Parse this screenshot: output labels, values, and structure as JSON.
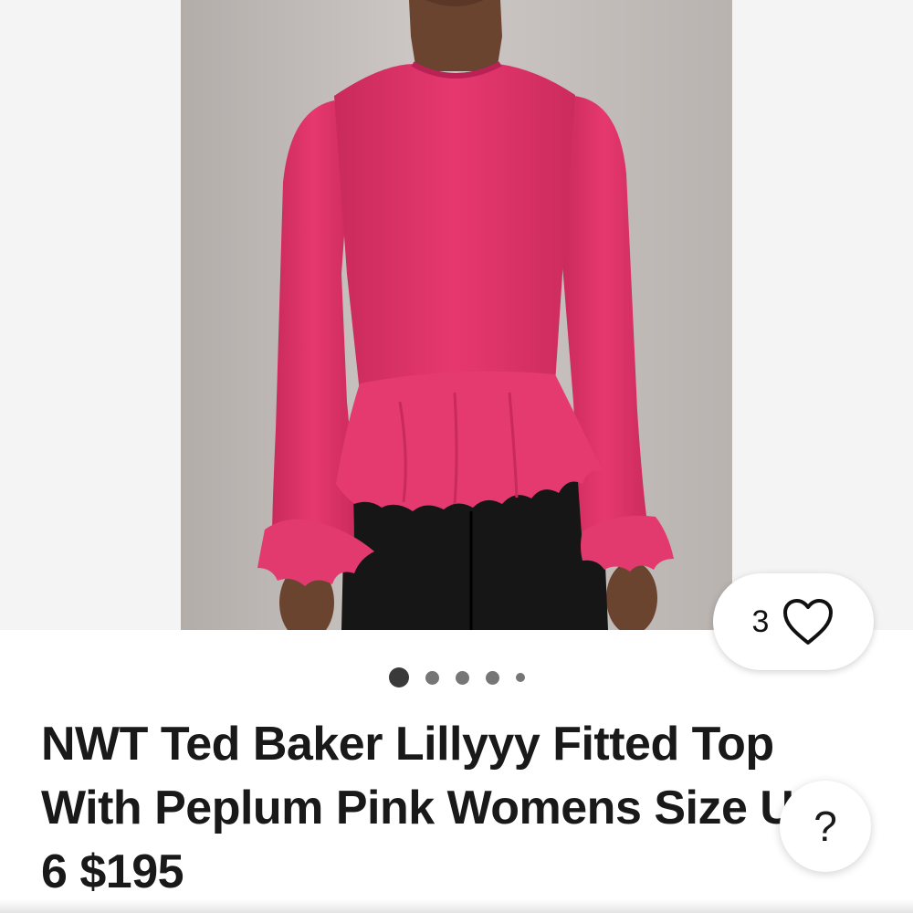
{
  "gallery": {
    "image_alt": "Pink peplum top worn by model",
    "like_count": "3",
    "heart_icon": "heart-outline-icon",
    "dot_count": 5,
    "active_dot": 1
  },
  "listing": {
    "title": "NWT Ted Baker Lillyyy Fitted Top With Peplum Pink Womens Size US 6 $195"
  },
  "help": {
    "label": "?"
  },
  "colors": {
    "garment": "#e0346a",
    "background": "#ffffff"
  }
}
